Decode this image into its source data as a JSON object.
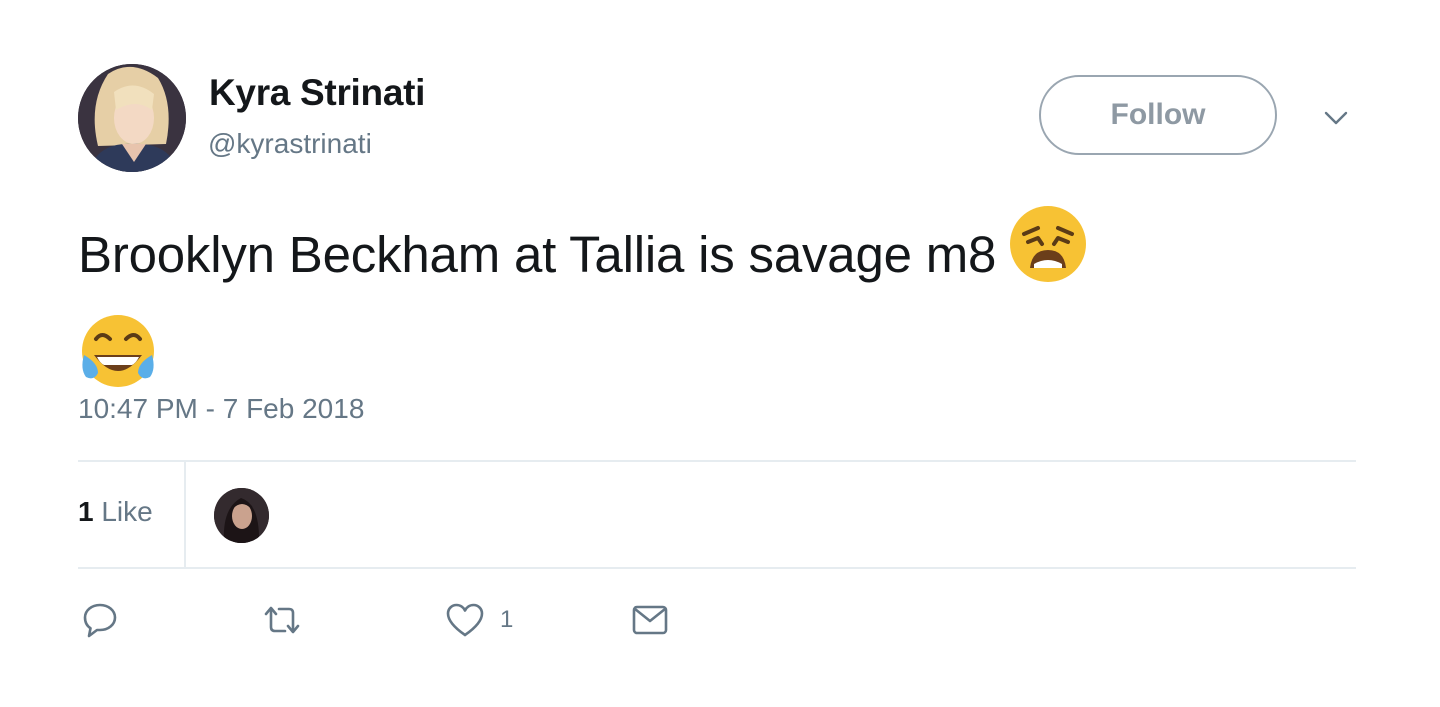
{
  "author": {
    "display_name": "Kyra Strinati",
    "handle": "@kyrastrinati"
  },
  "follow_label": "Follow",
  "tweet": {
    "text": "Brooklyn Beckham at Tallia is savage m8",
    "emojis": [
      "weary-face-emoji",
      "face-with-tears-of-joy-emoji"
    ],
    "timestamp": "10:47 PM - 7 Feb 2018"
  },
  "stats": {
    "likes_count": "1",
    "likes_label": "Like"
  },
  "actions": {
    "reply_icon": "reply-icon",
    "retweet_icon": "retweet-icon",
    "like_icon": "heart-icon",
    "like_count": "1",
    "dm_icon": "envelope-icon"
  },
  "colors": {
    "primary_text": "#14171a",
    "secondary_text": "#657786",
    "divider": "#e6ecf0",
    "emoji_yellow": "#f7c234"
  }
}
